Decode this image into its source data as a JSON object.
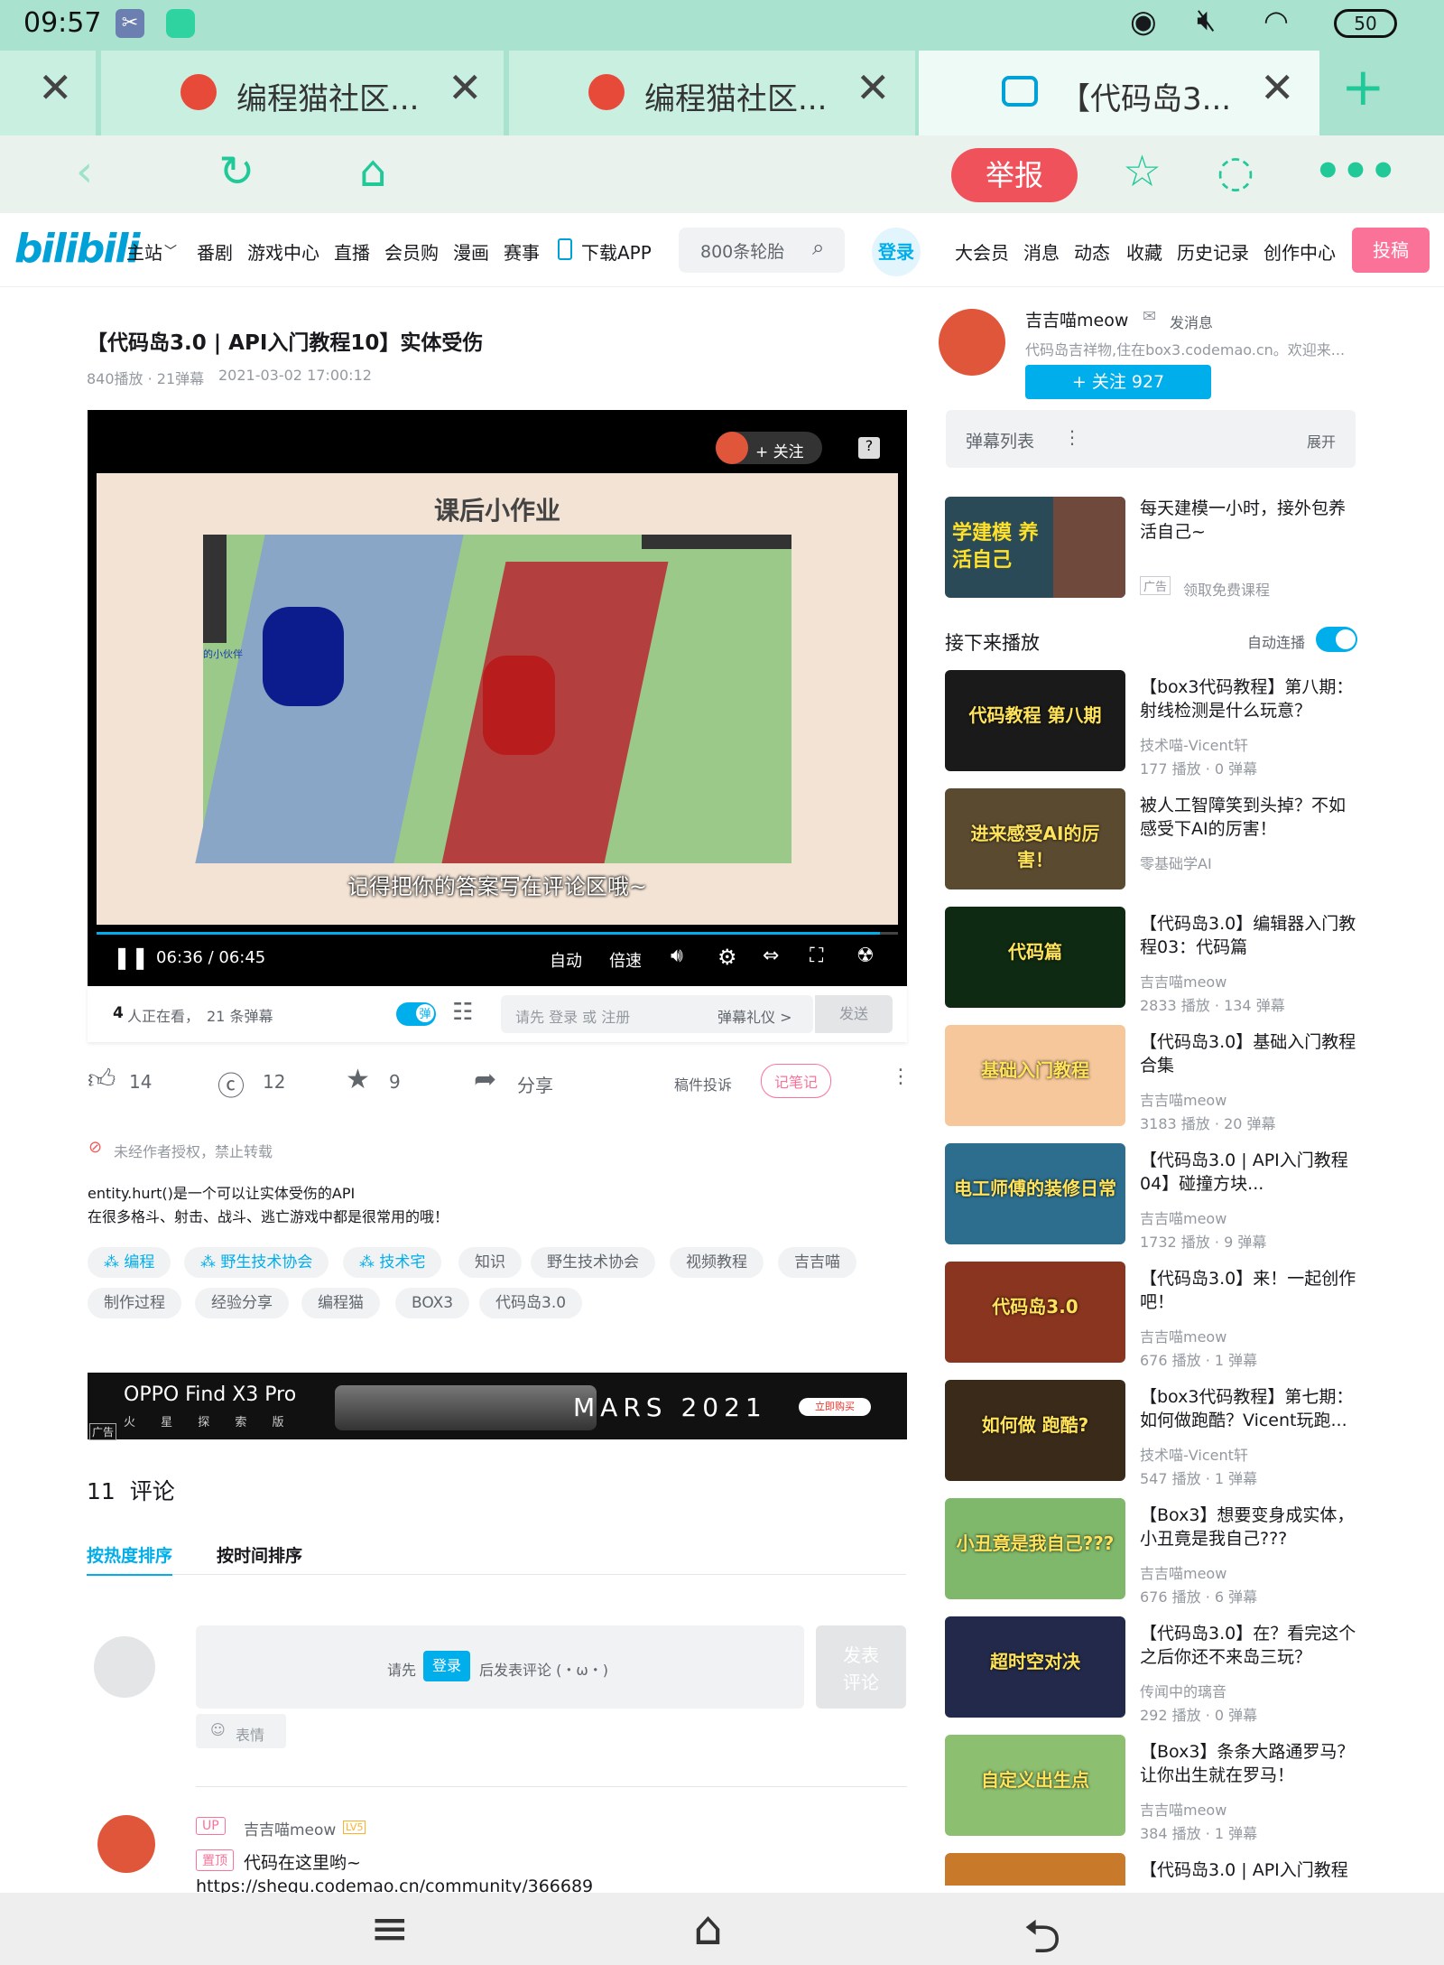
{
  "status": {
    "time": "09:57",
    "battery": "50"
  },
  "tabs": [
    {
      "title": "编程猫社区..."
    },
    {
      "title": "编程猫社区..."
    },
    {
      "title": "【代码岛3..."
    }
  ],
  "toolbar": {
    "report": "举报"
  },
  "nav": {
    "logo": "bilibili",
    "items": [
      "主站",
      "番剧",
      "游戏中心",
      "直播",
      "会员购",
      "漫画",
      "赛事",
      "下载APP"
    ],
    "search_placeholder": "800条轮胎",
    "login": "登录",
    "right": [
      "大会员",
      "消息",
      "动态",
      "收藏",
      "历史记录",
      "创作中心"
    ],
    "post": "投稿"
  },
  "video": {
    "title": "【代码岛3.0 | API入门教程10】实体受伤",
    "meta": "840播放 · 21弹幕",
    "date": "2021-03-02 17:00:12",
    "frame_title": "课后小作业",
    "subtitle": "记得把你的答案写在评论区哦~",
    "player_follow": "+ 关注",
    "time": "06:36 / 06:45",
    "quality": "自动",
    "speed": "倍速",
    "progress": 0.977,
    "game_label": "的小伙伴"
  },
  "danmu": {
    "watching_count": "4",
    "watching": "人正在看，",
    "count": "21 条弹幕",
    "toggle": "弹",
    "input": "请先 登录 或 注册",
    "gift": "弹幕礼仪 >",
    "send": "发送"
  },
  "actions": {
    "like": "14",
    "coin": "12",
    "fav": "9",
    "share": "分享",
    "complain": "稿件投诉",
    "note": "记笔记"
  },
  "desc": {
    "warning": "未经作者授权，禁止转载",
    "line1": "entity.hurt()是一个可以让实体受伤的API",
    "line2": "在很多格斗、射击、战斗、逃亡游戏中都是很常用的哦！"
  },
  "tags": [
    {
      "label": "编程",
      "blue": true
    },
    {
      "label": "野生技术协会",
      "blue": true
    },
    {
      "label": "技术宅",
      "blue": true
    },
    {
      "label": "知识"
    },
    {
      "label": "野生技术协会"
    },
    {
      "label": "视频教程"
    },
    {
      "label": "吉吉喵"
    },
    {
      "label": "制作过程"
    },
    {
      "label": "经验分享"
    },
    {
      "label": "编程猫"
    },
    {
      "label": "BOX3"
    },
    {
      "label": "代码岛3.0"
    }
  ],
  "ad": {
    "brand": "OPPO Find X3 Pro",
    "sub": "火 星 探 索 版",
    "text": "MARS 2021",
    "buy": "立即购买",
    "badge": "广告"
  },
  "comments": {
    "count": "11",
    "label": "评论",
    "sort_hot": "按热度排序",
    "sort_time": "按时间排序",
    "input_pre": "请先",
    "input_login": "登录",
    "input_post": "后发表评论 (・ω・)",
    "send": "发表\n评论",
    "emoji": "表情",
    "first": {
      "badge": "UP",
      "name": "吉吉喵meow",
      "level": "LV5",
      "pin": "置顶",
      "text": "代码在这里哟~",
      "link": "https://shequ.codemao.cn/community/366689"
    }
  },
  "up": {
    "name": "吉吉喵meow",
    "msg": "发消息",
    "desc": "代码岛吉祥物,住在box3.codemao.cn。欢迎来...",
    "follow": "+ 关注 927"
  },
  "dmlist": {
    "label": "弹幕列表",
    "expand": "展开"
  },
  "ad_card": {
    "title": "每天建模一小时，接外包养活自己~",
    "badge": "广告",
    "action": "领取免费课程",
    "thumb": "学建模 养活自己"
  },
  "next": {
    "label": "接下来播放",
    "autoplay": "自动连播"
  },
  "recs": [
    {
      "title": "【box3代码教程】第八期：射线检测是什么玩意？",
      "author": "技术喵-Vicent轩",
      "stats": "177 播放 · 0 弹幕",
      "thumb": "代码教程 第八期",
      "color": "#1a1a1a"
    },
    {
      "title": "被人工智障笑到头掉？不如感受下AI的厉害！",
      "author": "零基础学AI",
      "stats": "",
      "thumb": "进来感受AI的厉害！",
      "color": "#5a4a30"
    },
    {
      "title": "【代码岛3.0】编辑器入门教程03：代码篇",
      "author": "吉吉喵meow",
      "stats": "2833 播放 · 134 弹幕",
      "thumb": "代码篇",
      "color": "#0e2a12"
    },
    {
      "title": "【代码岛3.0】基础入门教程合集",
      "author": "吉吉喵meow",
      "stats": "3183 播放 · 20 弹幕",
      "thumb": "基础入门教程",
      "color": "#f6c79a"
    },
    {
      "title": "【代码岛3.0 | API入门教程04】碰撞方块...",
      "author": "吉吉喵meow",
      "stats": "1732 播放 · 9 弹幕",
      "thumb": "电工师傅的装修日常",
      "color": "#2d6e8e"
    },
    {
      "title": "【代码岛3.0】来！一起创作吧！",
      "author": "吉吉喵meow",
      "stats": "676 播放 · 1 弹幕",
      "thumb": "代码岛3.0",
      "color": "#8a3520"
    },
    {
      "title": "【box3代码教程】第七期：如何做跑酷？Vicent玩跑...",
      "author": "技术喵-Vicent轩",
      "stats": "547 播放 · 1 弹幕",
      "thumb": "如何做 跑酷?",
      "color": "#3a2a1a"
    },
    {
      "title": "【Box3】想要变身成实体，小丑竟是我自己???",
      "author": "吉吉喵meow",
      "stats": "676 播放 · 6 弹幕",
      "thumb": "小丑竟是我自己???",
      "color": "#7fb86a"
    },
    {
      "title": "【代码岛3.0】在？看完这个之后你还不来岛三玩？",
      "author": "传闻中的璃音",
      "stats": "292 播放 · 0 弹幕",
      "thumb": "超时空对决",
      "color": "#22294a"
    },
    {
      "title": "【Box3】条条大路通罗马？让你出生就在罗马！",
      "author": "吉吉喵meow",
      "stats": "384 播放 · 1 弹幕",
      "thumb": "自定义出生点",
      "color": "#8cc070"
    },
    {
      "title": "【代码岛3.0 | API入门教程",
      "author": "",
      "stats": "",
      "thumb": "",
      "color": "#c8792a"
    }
  ]
}
